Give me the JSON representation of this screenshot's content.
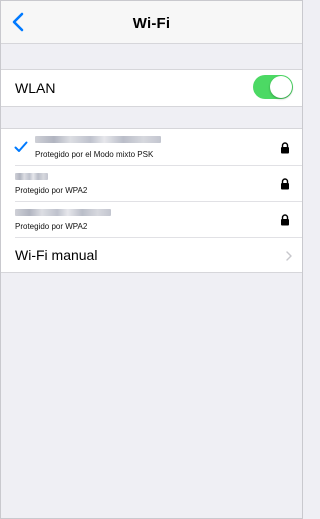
{
  "nav": {
    "title": "Wi-Fi",
    "back_icon": "chevron-left-icon"
  },
  "wlan": {
    "label": "WLAN",
    "enabled": true,
    "toggle_color": "#4cd964"
  },
  "networks": [
    {
      "connected": true,
      "security": "Protegido por el Modo mixto PSK",
      "locked": true
    },
    {
      "connected": false,
      "security": "Protegido por WPA2",
      "locked": true
    },
    {
      "connected": false,
      "security": "Protegido por WPA2",
      "locked": true
    }
  ],
  "manual": {
    "label": "Wi-Fi manual"
  },
  "colors": {
    "accent": "#007aff",
    "background": "#efeff4",
    "switch_on": "#4cd964"
  }
}
